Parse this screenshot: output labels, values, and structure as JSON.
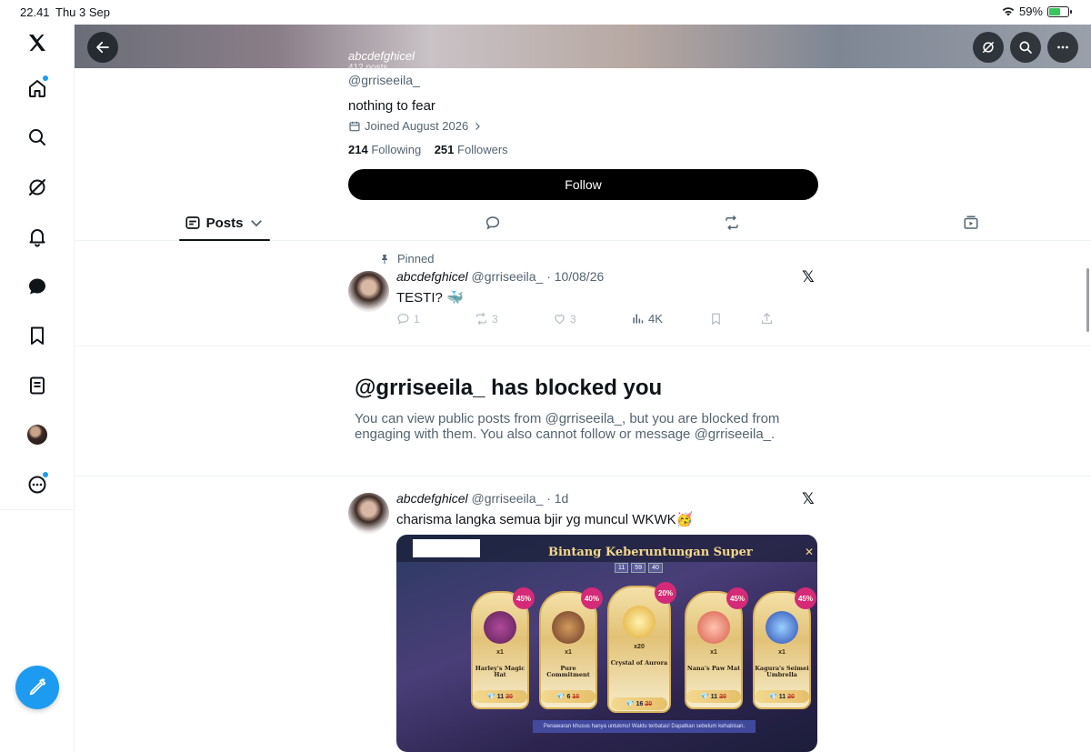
{
  "status_bar": {
    "time": "22.41",
    "date": "Thu 3 Sep",
    "battery": "59%"
  },
  "sidebar": {
    "items": [
      "x-logo",
      "home",
      "explore",
      "grok",
      "notifications",
      "messages",
      "bookmarks",
      "lists",
      "profile",
      "more"
    ]
  },
  "profile": {
    "header_name": "abcdefghicel",
    "header_posts": "412 posts",
    "handle": "@grriseeila_",
    "bio": "nothing to fear",
    "joined": "Joined August 2026",
    "following_count": "214",
    "following_label": "Following",
    "followers_count": "251",
    "followers_label": "Followers",
    "follow_button": "Follow"
  },
  "tabs": {
    "posts_label": "Posts"
  },
  "pinned_post": {
    "pinned_label": "Pinned",
    "name": "abcdefghicel",
    "handle": "@grriseeila_",
    "time": "· 10/08/26",
    "text": "TESTI? 🐳",
    "replies": "1",
    "reposts": "3",
    "likes": "3",
    "views": "4K"
  },
  "blocked": {
    "title": "@grriseeila_ has blocked you",
    "text": "You can view public posts from @grriseeila_, but you are blocked from engaging with them. You also cannot follow or message @grriseeila_."
  },
  "second_post": {
    "name": "abcdefghicel",
    "handle": "@grriseeila_",
    "time": "· 1d",
    "text": "charisma langka semua bjir yg muncul WKWK🥳"
  },
  "game": {
    "title": "Bintang Keberuntungan Super",
    "timer": [
      "11",
      "59",
      "40"
    ],
    "cards": [
      {
        "name": "Harley's Magic Hat",
        "qty": "x1",
        "discount": "45%",
        "price": "11",
        "old": "20",
        "color": "#7a2b6e"
      },
      {
        "name": "Pure Commitment",
        "qty": "x1",
        "discount": "40%",
        "price": "6",
        "old": "10",
        "color": "#8a5a3a"
      },
      {
        "name": "Crystal of Aurora",
        "qty": "x20",
        "discount": "20%",
        "price": "16",
        "old": "20",
        "color": "#e6b84a"
      },
      {
        "name": "Nana's Paw Mat",
        "qty": "x1",
        "discount": "45%",
        "price": "11",
        "old": "20",
        "color": "#e07a6a"
      },
      {
        "name": "Kagura's Seimei Umbrella",
        "qty": "x1",
        "discount": "45%",
        "price": "11",
        "old": "20",
        "color": "#3a6ad0"
      }
    ],
    "offer": "Penawaran khusus hanya untukmu! Waktu terbatas! Dapatkan sebelum kehabisan."
  }
}
